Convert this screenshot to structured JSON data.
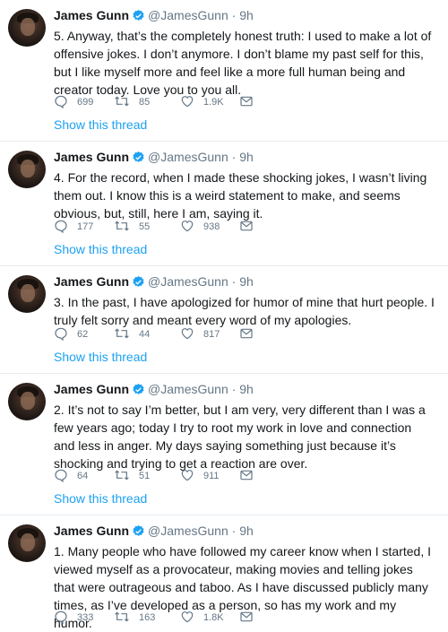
{
  "tweets": [
    {
      "name": "James Gunn",
      "handle": "@JamesGunn",
      "separator": "·",
      "time": "9h",
      "text": "5. Anyway, that’s the completely honest truth: I used to make a lot of offensive jokes. I don’t anymore. I don’t blame my past self for this, but I like myself more and feel like a more full human being and creator today.  Love you to you all.",
      "replies": "699",
      "retweets": "85",
      "likes": "1.9K",
      "show_thread": "Show this thread"
    },
    {
      "name": "James Gunn",
      "handle": "@JamesGunn",
      "separator": "·",
      "time": "9h",
      "text": "4. For the record, when I made these shocking jokes, I wasn’t living them out. I know this is a weird statement to make, and seems obvious, but, still, here I am, saying it.",
      "replies": "177",
      "retweets": "55",
      "likes": "938",
      "show_thread": "Show this thread"
    },
    {
      "name": "James Gunn",
      "handle": "@JamesGunn",
      "separator": "·",
      "time": "9h",
      "text": "3. In the past, I have apologized for humor of mine that hurt people. I truly felt sorry and meant every word of my apologies.",
      "replies": "62",
      "retweets": "44",
      "likes": "817",
      "show_thread": "Show this thread"
    },
    {
      "name": "James Gunn",
      "handle": "@JamesGunn",
      "separator": "·",
      "time": "9h",
      "text": "2. It’s not to say I’m better, but I am very, very different than I was a few years ago; today I try to root my work in love and connection and less in anger.  My days saying something just because it’s shocking and trying to get a reaction are over.",
      "replies": "64",
      "retweets": "51",
      "likes": "911",
      "show_thread": "Show this thread"
    },
    {
      "name": "James Gunn",
      "handle": "@JamesGunn",
      "separator": "·",
      "time": "9h",
      "text": "1. Many people who have followed my career know when I started, I viewed myself as a provocateur, making movies and telling jokes that were outrageous and taboo. As I have discussed publicly many times, as I’ve developed as a person, so has my work and my humor.",
      "replies": "333",
      "retweets": "163",
      "likes": "1.8K",
      "show_thread": ""
    }
  ],
  "colors": {
    "link": "#1da1f2",
    "verified": "#1da1f2",
    "muted": "#657786",
    "divider": "#e6ecf0"
  },
  "icons": [
    "reply-icon",
    "retweet-icon",
    "like-icon",
    "direct-message-icon",
    "verified-badge-icon"
  ]
}
